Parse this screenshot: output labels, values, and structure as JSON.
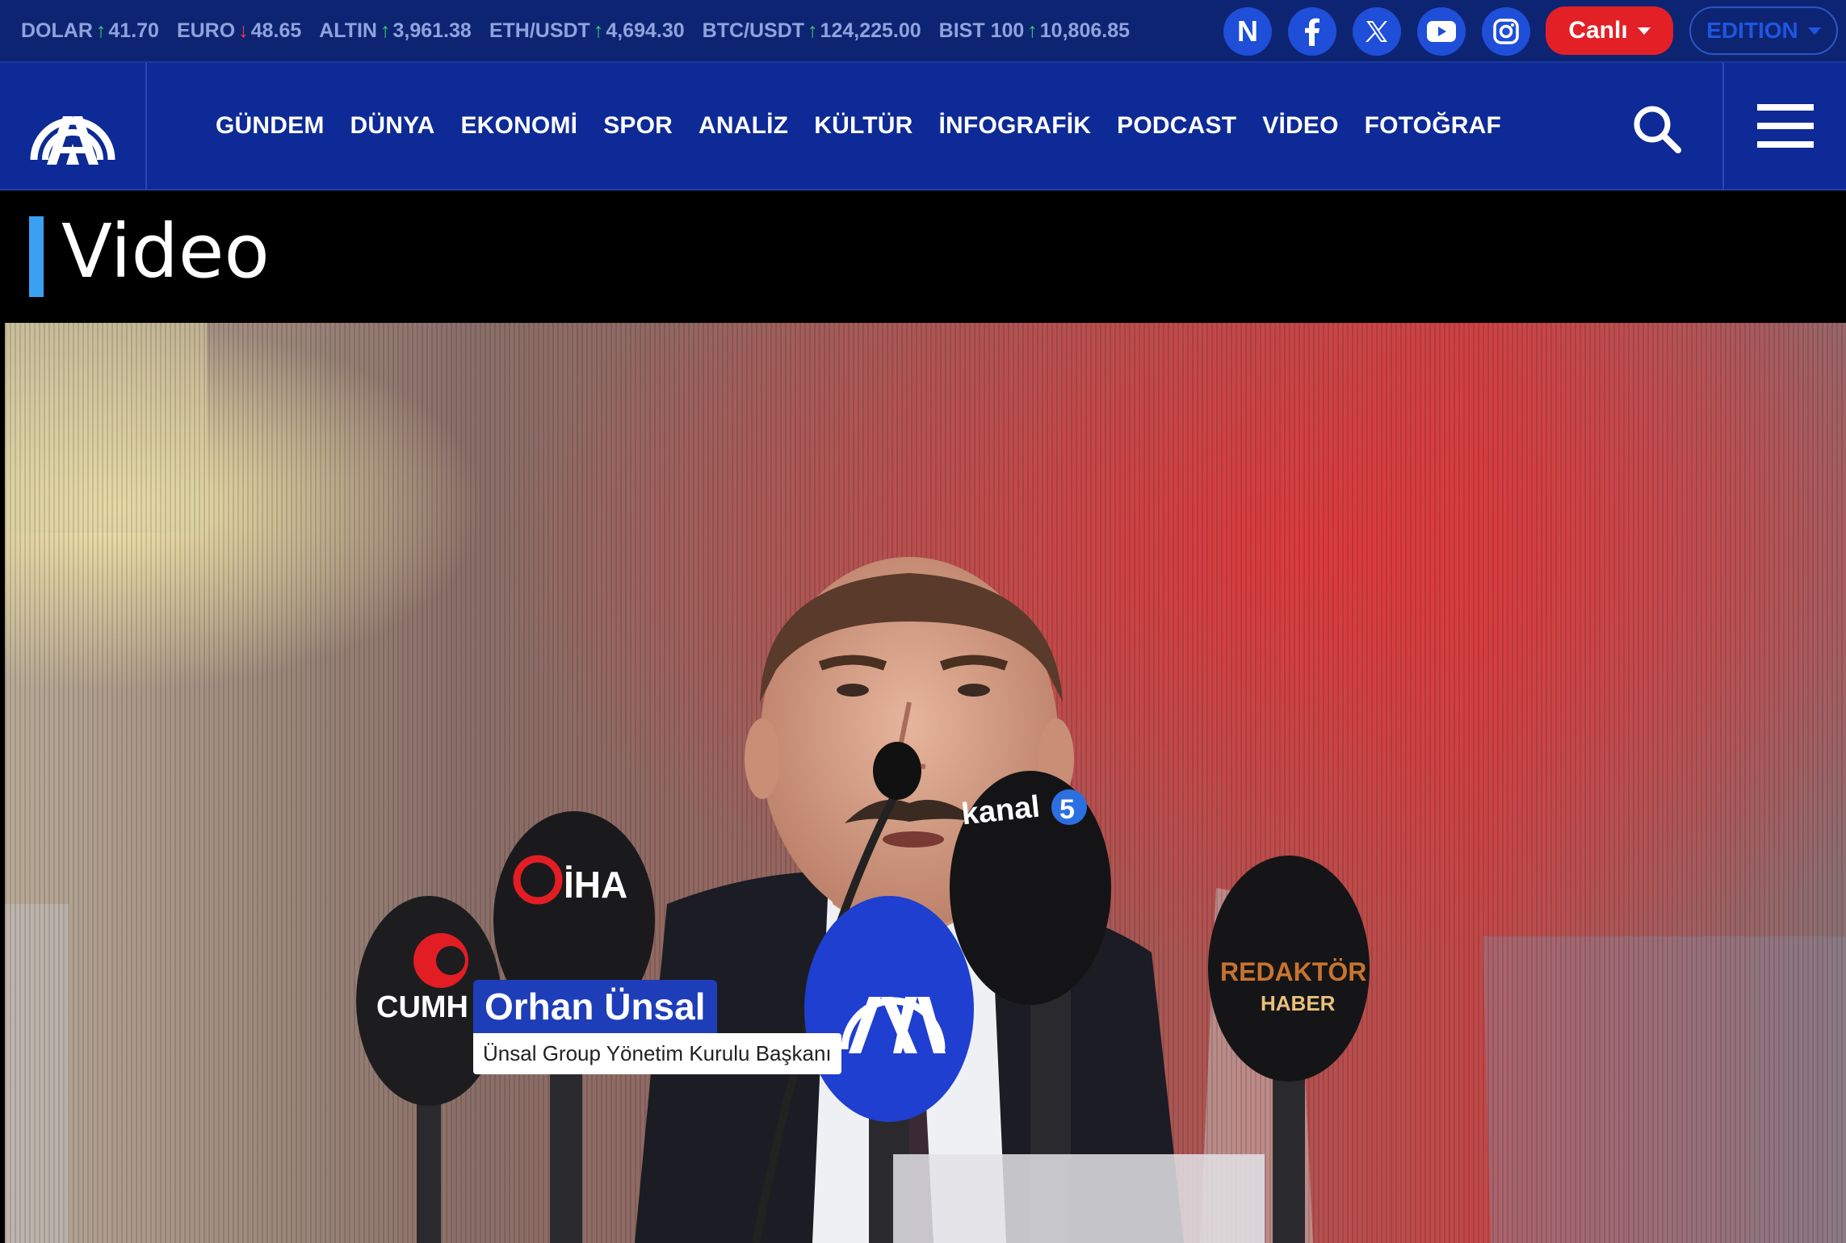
{
  "ticker": [
    {
      "name": "DOLAR",
      "direction": "up",
      "arrow": "↑",
      "value": "41.70"
    },
    {
      "name": "EURO",
      "direction": "down",
      "arrow": "↓",
      "value": "48.65"
    },
    {
      "name": "ALTIN",
      "direction": "up",
      "arrow": "↑",
      "value": "3,961.38"
    },
    {
      "name": "ETH/USDT",
      "direction": "up",
      "arrow": "↑",
      "value": "4,694.30"
    },
    {
      "name": "BTC/USDT",
      "direction": "up",
      "arrow": "↑",
      "value": "124,225.00"
    },
    {
      "name": "BIST 100",
      "direction": "up",
      "arrow": "↑",
      "value": "10,806.85"
    }
  ],
  "social": {
    "n_label": "N",
    "icons": [
      "n-icon",
      "facebook-icon",
      "x-icon",
      "youtube-icon",
      "instagram-icon"
    ]
  },
  "live_label": "Canlı",
  "edition_label": "EDITION",
  "nav": {
    "items": [
      "GÜNDEM",
      "DÜNYA",
      "EKONOMİ",
      "SPOR",
      "ANALİZ",
      "KÜLTÜR",
      "İNFOGRAFİK",
      "PODCAST",
      "VİDEO",
      "FOTOĞRAF"
    ]
  },
  "section": {
    "title": "Video"
  },
  "video": {
    "speaker_name": "Orhan Ünsal",
    "speaker_title": "Ünsal Group Yönetim Kurulu Başkanı",
    "mic_labels": {
      "cumhuriyet": "CUMH",
      "iha": "İHA",
      "kanal5": "kanal",
      "kanal5_num": "5",
      "redaktor": "REDAKTÖR",
      "redaktor_sub": "HABER"
    }
  },
  "colors": {
    "topbar": "#0d2473",
    "navbar": "#0e2a96",
    "accent": "#3aa0f0",
    "live": "#e32026",
    "up": "#2ed16b",
    "down": "#ff3b3b"
  }
}
